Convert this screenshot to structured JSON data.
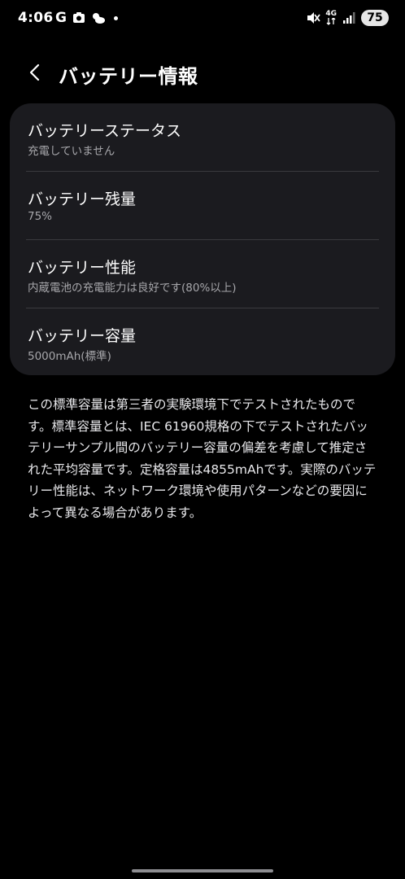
{
  "status_bar": {
    "time": "4:06",
    "g_letter": "G",
    "network_label": "4G",
    "battery_level": "75",
    "icons": [
      "google-icon",
      "app-icon",
      "weather-icon",
      "notification-dot-icon",
      "mute-icon",
      "network-4g-icon",
      "signal-icon",
      "battery-icon"
    ]
  },
  "header": {
    "title": "バッテリー情報",
    "back_icon": "chevron-left-icon"
  },
  "items": [
    {
      "title": "バッテリーステータス",
      "value": "充電していません"
    },
    {
      "title": "バッテリー残量",
      "value": "75%"
    },
    {
      "title": "バッテリー性能",
      "value": "内蔵電池の充電能力は良好です(80%以上)"
    },
    {
      "title": "バッテリー容量",
      "value": "5000mAh(標準)"
    }
  ],
  "description": "この標準容量は第三者の実験環境下でテストされたものです。標準容量とは、IEC 61960規格の下でテストされたバッテリーサンプル間のバッテリー容量の偏差を考慮して推定された平均容量です。定格容量は4855mAhです。実際のバッテリー性能は、ネットワーク環境や使用パターンなどの要因によって異なる場合があります。",
  "colors": {
    "background": "#000000",
    "card": "#1b1b1f",
    "primary_text": "#ffffff",
    "secondary_text": "#a7a7ab",
    "divider": "#3a3a3e"
  }
}
